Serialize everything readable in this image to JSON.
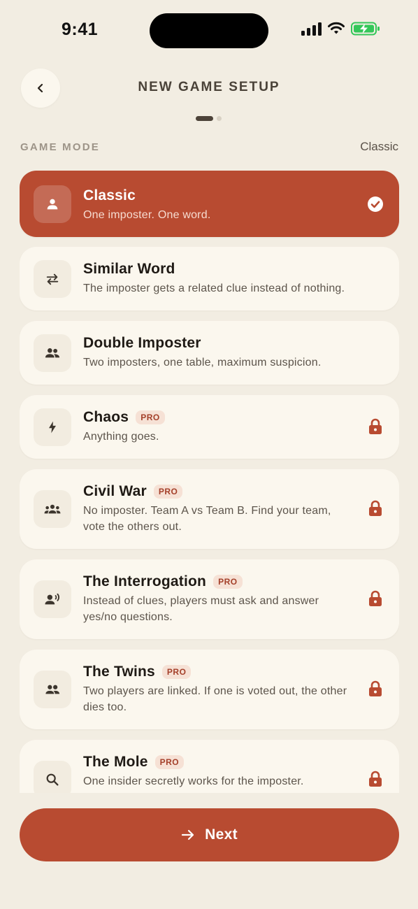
{
  "status": {
    "time": "9:41"
  },
  "header": {
    "title": "NEW GAME SETUP"
  },
  "section": {
    "label": "GAME MODE",
    "value": "Classic"
  },
  "modes": [
    {
      "name": "Classic",
      "desc": "One imposter. One word.",
      "icon": "person-icon",
      "selected": true,
      "pro": false
    },
    {
      "name": "Similar Word",
      "desc": "The imposter gets a related clue instead of nothing.",
      "icon": "swap-arrows-icon",
      "selected": false,
      "pro": false
    },
    {
      "name": "Double Imposter",
      "desc": "Two imposters, one table, maximum suspicion.",
      "icon": "group-icon",
      "selected": false,
      "pro": false
    },
    {
      "name": "Chaos",
      "desc": "Anything goes.",
      "icon": "bolt-icon",
      "selected": false,
      "pro": true
    },
    {
      "name": "Civil War",
      "desc": "No imposter. Team A vs Team B. Find your team, vote the others out.",
      "icon": "groups-icon",
      "selected": false,
      "pro": true
    },
    {
      "name": "The Interrogation",
      "desc": "Instead of clues, players must ask and answer yes/no questions.",
      "icon": "speaking-person-icon",
      "selected": false,
      "pro": true
    },
    {
      "name": "The Twins",
      "desc": "Two players are linked. If one is voted out, the other dies too.",
      "icon": "people-icon",
      "selected": false,
      "pro": true
    },
    {
      "name": "The Mole",
      "desc": "One insider secretly works for the imposter.",
      "icon": "search-icon",
      "selected": false,
      "pro": true
    }
  ],
  "badge": {
    "pro": "PRO"
  },
  "footer": {
    "next_label": "Next"
  },
  "colors": {
    "accent": "#b84b31",
    "background": "#f2ede2",
    "card": "#fbf7ee",
    "battery": "#34c759"
  }
}
